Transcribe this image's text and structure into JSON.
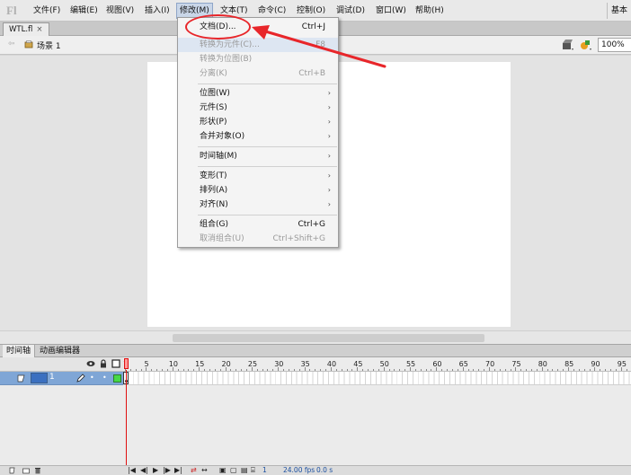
{
  "menubar": {
    "items": [
      {
        "label": "文件(F)"
      },
      {
        "label": "编辑(E)"
      },
      {
        "label": "视图(V)"
      },
      {
        "label": "插入(I)"
      },
      {
        "label": "修改(M)"
      },
      {
        "label": "文本(T)"
      },
      {
        "label": "命令(C)"
      },
      {
        "label": "控制(O)"
      },
      {
        "label": "调试(D)"
      },
      {
        "label": "窗口(W)"
      },
      {
        "label": "帮助(H)"
      }
    ],
    "workspace": "基本"
  },
  "document_tab": {
    "label": "WTL.fl",
    "close": "×"
  },
  "editbar": {
    "scene_label": "场景 1",
    "zoom": "100%"
  },
  "modify_menu": {
    "items": [
      {
        "label": "文档(D)...",
        "shortcut": "Ctrl+J"
      },
      {
        "label": "转换为元件(C)...",
        "shortcut": "F8"
      },
      {
        "label": "转换为位图(B)",
        "shortcut": ""
      },
      {
        "label": "分离(K)",
        "shortcut": "Ctrl+B"
      },
      {
        "label": "位图(W)",
        "shortcut": ""
      },
      {
        "label": "元件(S)",
        "shortcut": ""
      },
      {
        "label": "形状(P)",
        "shortcut": ""
      },
      {
        "label": "合并对象(O)",
        "shortcut": ""
      },
      {
        "label": "时间轴(M)",
        "shortcut": ""
      },
      {
        "label": "变形(T)",
        "shortcut": ""
      },
      {
        "label": "排列(A)",
        "shortcut": ""
      },
      {
        "label": "对齐(N)",
        "shortcut": ""
      },
      {
        "label": "组合(G)",
        "shortcut": "Ctrl+G"
      },
      {
        "label": "取消组合(U)",
        "shortcut": "Ctrl+Shift+G"
      }
    ]
  },
  "panel_tabs": [
    {
      "label": "时间轴"
    },
    {
      "label": "动画编辑器"
    }
  ],
  "timeline": {
    "frame_numbers": [
      "1",
      "5",
      "10",
      "15",
      "20",
      "25",
      "30",
      "35",
      "40",
      "45",
      "50",
      "55",
      "60",
      "65",
      "70",
      "75",
      "80",
      "85",
      "90",
      "95"
    ],
    "layer": {
      "name": "1"
    },
    "footer": {
      "current_frame": "1",
      "fps": "24.00 fps",
      "time": "0.0 s"
    }
  },
  "colors": {
    "accent_red": "#e8262a",
    "layer_selected": "#7fa6d6",
    "layer_color": "#47d847"
  }
}
